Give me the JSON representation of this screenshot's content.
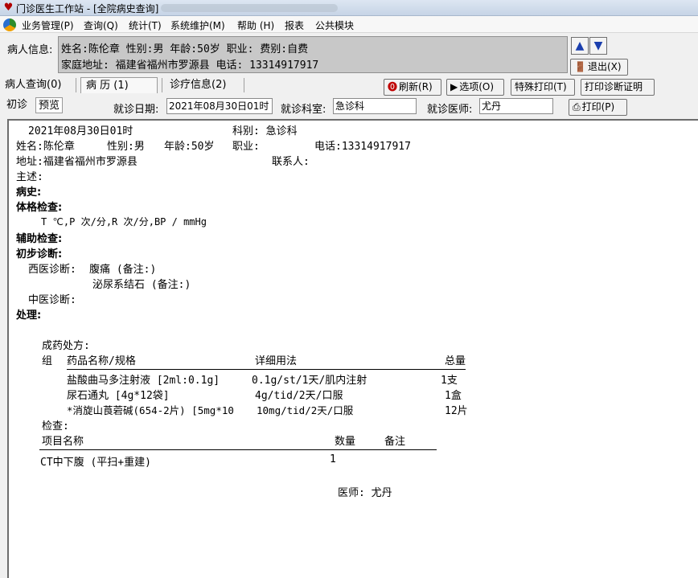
{
  "window": {
    "title": "门诊医生工作站 - [全院病史查询]"
  },
  "menu": [
    "业务管理(P)",
    "查询(Q)",
    "统计(T)",
    "系统维护(M)",
    "帮助 (H)",
    "报表",
    "公共模块"
  ],
  "patient": {
    "label": "病人信息:",
    "line1": "姓名:陈伦章 性别:男 年龄:50岁  职业: 费别:自费",
    "line2": "家庭地址: 福建省福州市罗源县 电话: 13314917917"
  },
  "buttons": {
    "exit": "退出(X)",
    "refresh": "刷新(R)",
    "options": "选项(O)",
    "special_print": "特殊打印(T)",
    "print_cert": "打印诊断证明",
    "print": "打印(P)"
  },
  "tabs": [
    "病人查询(0)",
    "病  历 (1)",
    "诊疗信息(2)"
  ],
  "subtabs": [
    "初诊",
    "预览"
  ],
  "visit": {
    "date_label": "就诊日期:",
    "date_value": "2021年08月30日01时",
    "dept_label": "就诊科室:",
    "dept_value": "急诊科",
    "doctor_label": "就诊医师:",
    "doctor_value": "尤丹"
  },
  "record": {
    "datetime": "2021年08月30日01时",
    "dept": "科别: 急诊科",
    "name": "姓名:陈伦章",
    "sex": "性别:男",
    "age": "年龄:50岁",
    "job": "职业:",
    "phone": "电话:13314917917",
    "address": "地址:福建省福州市罗源县",
    "contact": "联系人:",
    "complaint": "主述:",
    "history_title": "病史:",
    "exam_title": "体格检查:",
    "vitals": "T    ℃,P   次/分,R  次/分,BP   /   mmHg",
    "aux_title": "辅助检查:",
    "diag_title": "初步诊断:",
    "western_label": "西医诊断:",
    "western_1": "腹痛 (备注:)",
    "western_2": "泌尿系结石 (备注:)",
    "chinese_label": "中医诊断:",
    "treatment_title": "处理:",
    "rx_title": "成药处方:",
    "rx_headers": [
      "组",
      "药品名称/规格",
      "详细用法",
      "总量"
    ],
    "rx_rows": [
      {
        "name": "盐酸曲马多注射液 [2ml:0.1g]",
        "usage": "0.1g/st/1天/肌内注射",
        "total": "1支"
      },
      {
        "name": "尿石通丸 [4g*12袋]",
        "usage": "4g/tid/2天/口服",
        "total": "1盒"
      },
      {
        "name": "*消旋山莨菪碱(654-2片) [5mg*10",
        "usage": "10mg/tid/2天/口服",
        "total": "12片"
      }
    ],
    "check_title": "检查:",
    "check_headers": [
      "项目名称",
      "数量",
      "备注"
    ],
    "check_rows": [
      {
        "name": "CT中下腹 (平扫+重建)",
        "qty": "1",
        "note": ""
      }
    ],
    "doctor_sign": "医师: 尤丹"
  }
}
